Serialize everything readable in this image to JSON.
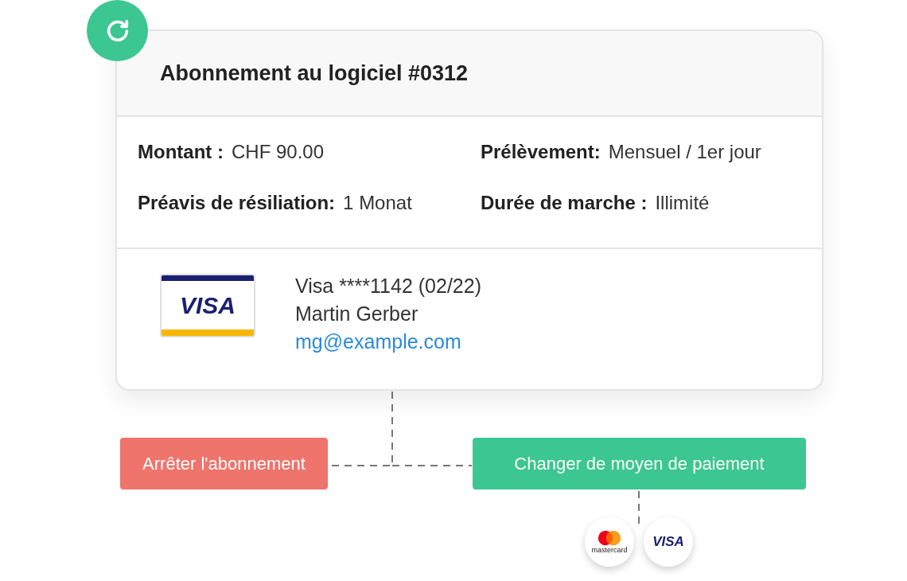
{
  "title": "Abonnement au logiciel #0312",
  "details": [
    {
      "label": "Montant :",
      "value": "CHF 90.00"
    },
    {
      "label": "Prélèvement:",
      "value": "Mensuel / 1er jour"
    },
    {
      "label": "Préavis de résiliation:",
      "value": "1 Monat"
    },
    {
      "label": "Durée de marche :",
      "value": "Illimité"
    }
  ],
  "payment": {
    "card_logo": "VISA",
    "card": "Visa ****1142 (02/22)",
    "name": "Martin Gerber",
    "email": "mg@example.com"
  },
  "actions": [
    {
      "label": "Arrêter l'abonnement",
      "kind": "danger"
    },
    {
      "label": "Changer de moyen de paiement",
      "kind": "primary"
    }
  ],
  "accepted_cards": [
    {
      "kind": "mastercard",
      "label": "mastercard"
    },
    {
      "kind": "visa",
      "label": "VISA"
    }
  ]
}
